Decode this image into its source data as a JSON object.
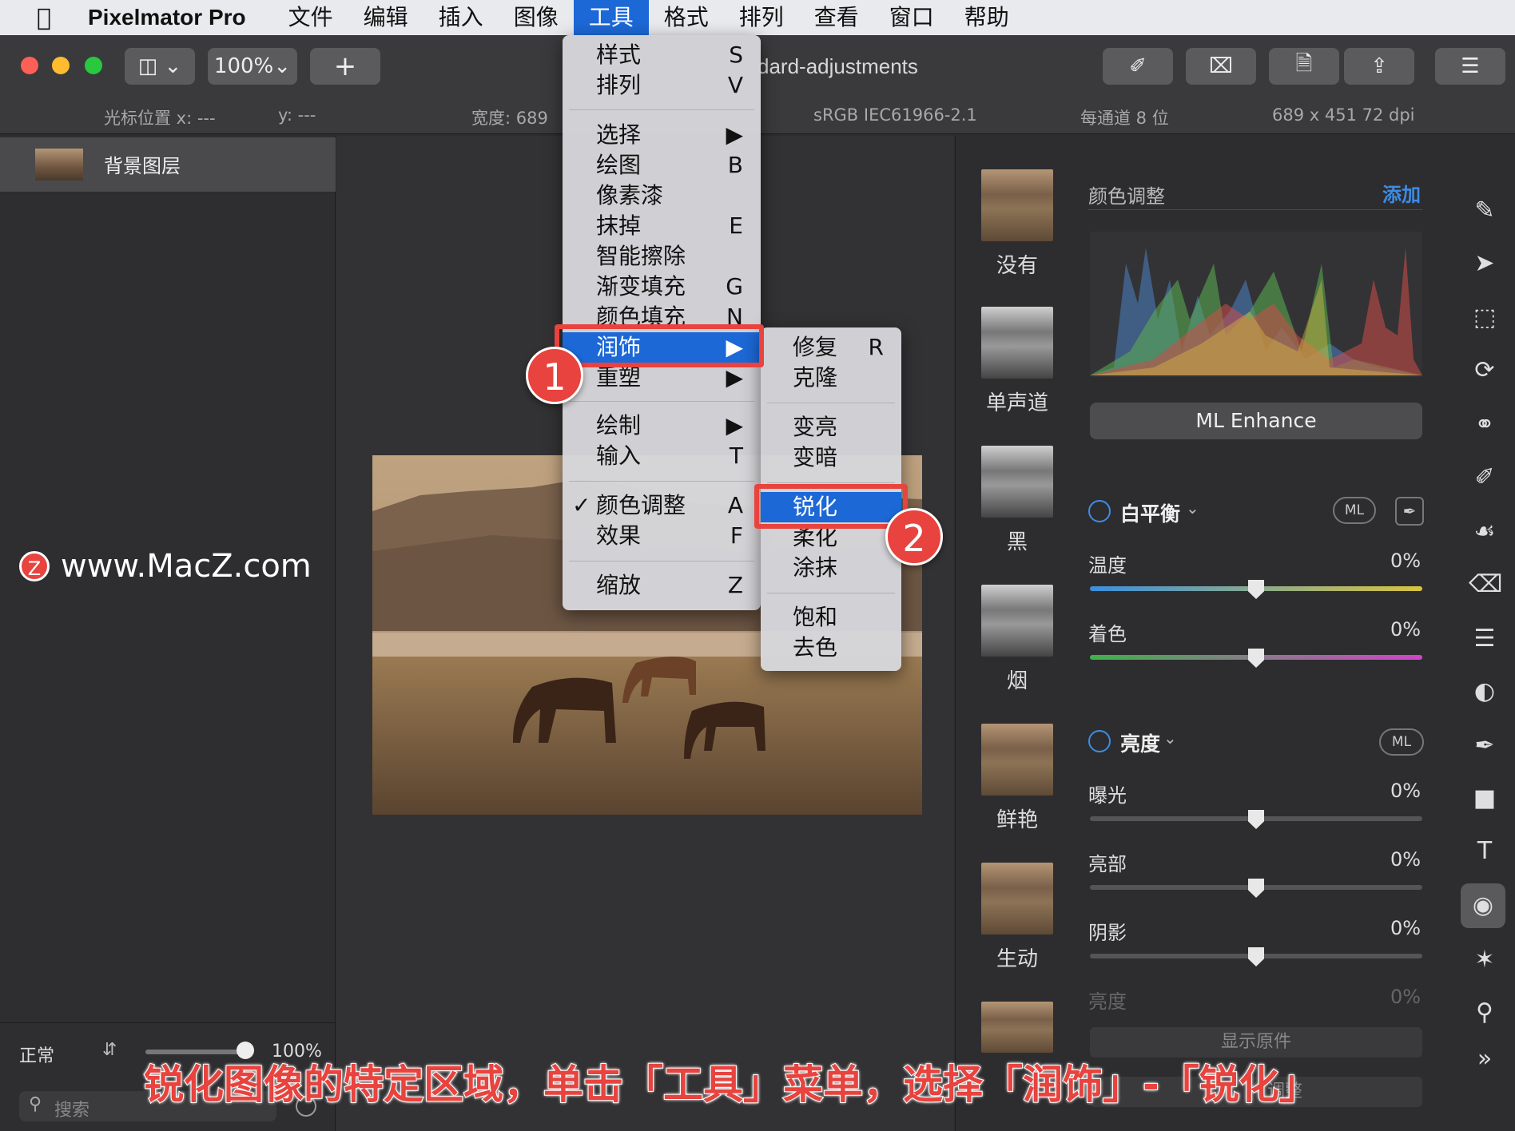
{
  "menubar": {
    "app_name": "Pixelmator Pro",
    "items": [
      "文件",
      "编辑",
      "插入",
      "图像",
      "工具",
      "格式",
      "排列",
      "查看",
      "窗口",
      "帮助"
    ],
    "active_index": 4
  },
  "toolbar": {
    "zoom": "100%",
    "add_label": "+",
    "doc_title": "dard-adjustments"
  },
  "info_bar": {
    "cursor_x": "光标位置 x:  ---",
    "cursor_y": "y:  ---",
    "width": "宽度:  689",
    "color_profile": "sRGB IEC61966-2.1",
    "bit_depth": "每通道 8 位",
    "dimensions": "689 x 451 72 dpi"
  },
  "layers": {
    "layer_name": "背景图层",
    "blend_mode": "正常",
    "opacity": "100%",
    "search_placeholder": "搜索"
  },
  "watermark": "www.MacZ.com",
  "tools_menu": {
    "items": [
      {
        "label": "样式",
        "key": "S"
      },
      {
        "label": "排列",
        "key": "V"
      },
      {
        "label": "选择",
        "key": "▶"
      },
      {
        "label": "绘图",
        "key": "B"
      },
      {
        "label": "像素漆",
        "key": ""
      },
      {
        "label": "抹掉",
        "key": "E"
      },
      {
        "label": "智能擦除",
        "key": ""
      },
      {
        "label": "渐变填充",
        "key": "G"
      },
      {
        "label": "颜色填充",
        "key": "N"
      },
      {
        "label": "润饰",
        "key": "▶"
      },
      {
        "label": "重塑",
        "key": "▶"
      },
      {
        "label": "绘制",
        "key": "▶"
      },
      {
        "label": "输入",
        "key": "T"
      },
      {
        "label": "颜色调整",
        "key": "A",
        "checked": true
      },
      {
        "label": "效果",
        "key": "F"
      },
      {
        "label": "缩放",
        "key": "Z"
      }
    ]
  },
  "retouch_submenu": {
    "items": [
      {
        "label": "修复",
        "key": "R"
      },
      {
        "label": "克隆",
        "key": ""
      },
      {
        "label": "变亮",
        "key": ""
      },
      {
        "label": "变暗",
        "key": ""
      },
      {
        "label": "锐化",
        "key": ""
      },
      {
        "label": "柔化",
        "key": ""
      },
      {
        "label": "涂抹",
        "key": ""
      },
      {
        "label": "饱和",
        "key": ""
      },
      {
        "label": "去色",
        "key": ""
      }
    ],
    "selected": "锐化"
  },
  "badges": [
    "1",
    "2"
  ],
  "presets": [
    "没有",
    "单声道",
    "黑",
    "烟",
    "鲜艳",
    "生动"
  ],
  "adjust": {
    "title": "颜色调整",
    "add": "添加",
    "ml_enhance": "ML Enhance",
    "white_balance": "白平衡",
    "ml": "ML",
    "temperature": "温度",
    "tint": "着色",
    "brightness": "亮度",
    "exposure": "曝光",
    "highlights": "亮部",
    "shadows": "阴影",
    "brightness2": "亮度",
    "zero": "0%",
    "show_original": "显示原件",
    "reset": "调整"
  },
  "caption": "锐化图像的特定区域，单击「工具」菜单，选择「润饰」-「锐化」",
  "colors": {
    "accent": "#1c68d6",
    "annotation": "#e8433e"
  }
}
